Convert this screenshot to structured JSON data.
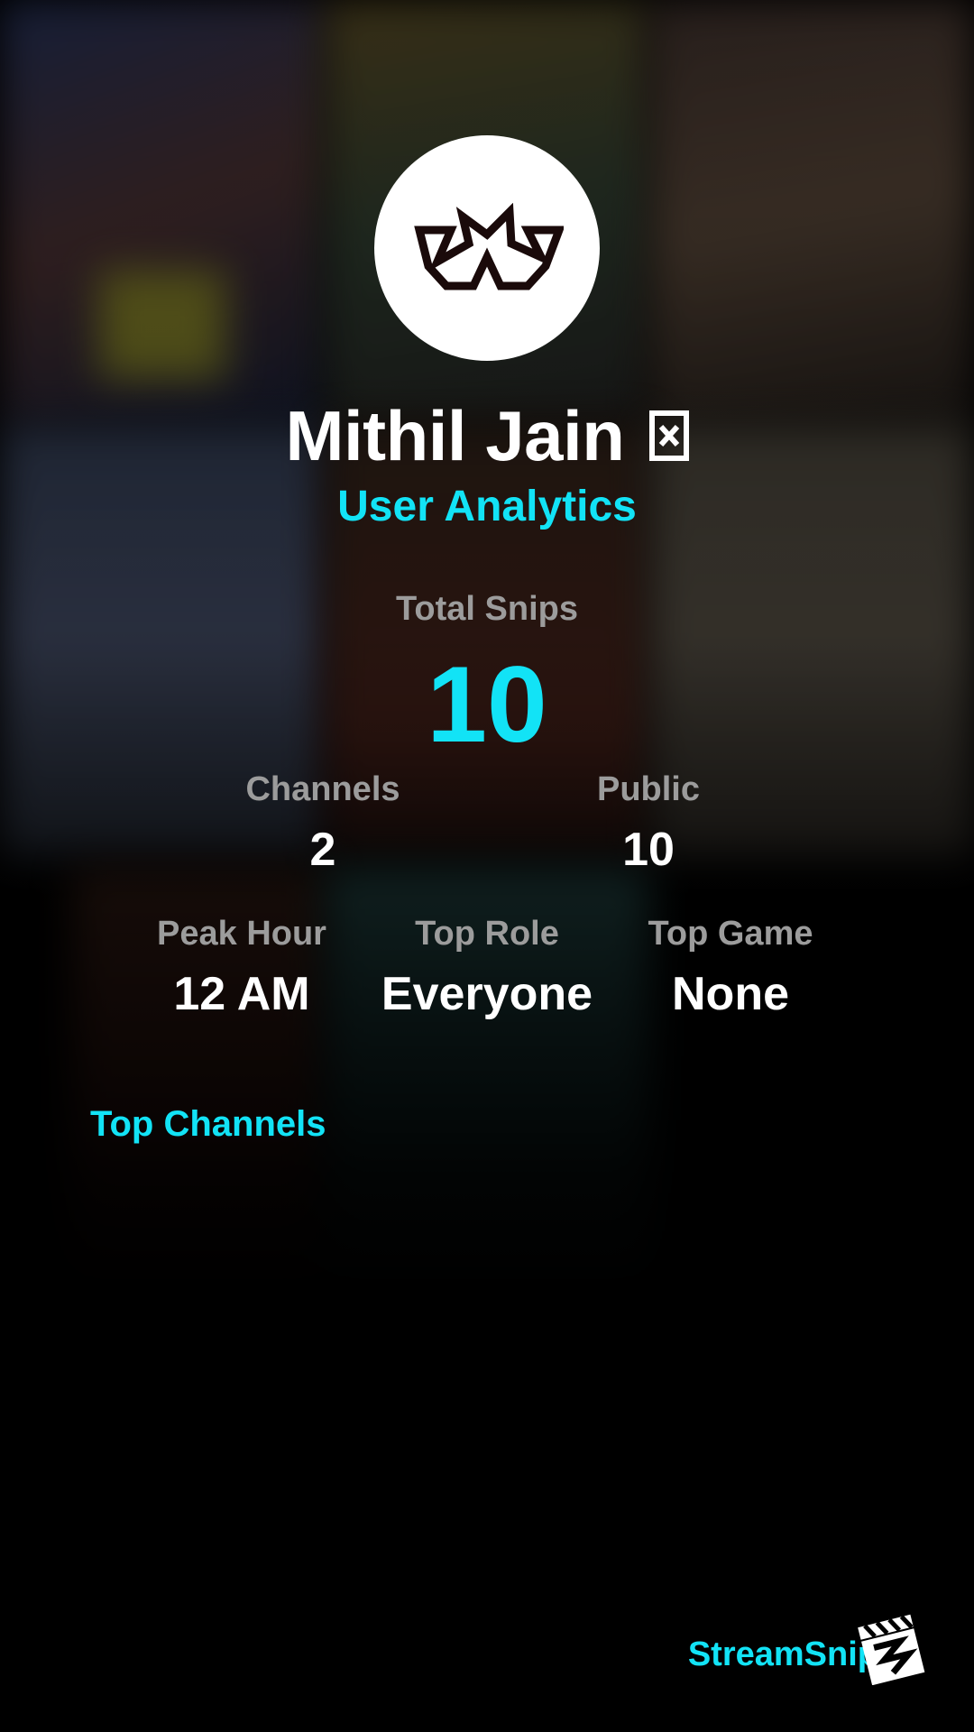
{
  "profile": {
    "username": "Mithil Jain",
    "title_icon": "boxed-x-icon",
    "avatar_icon": "crown-logo-icon",
    "subtitle": "User Analytics"
  },
  "stats": {
    "total_snips_label": "Total Snips",
    "total_snips_value": "10",
    "channels_label": "Channels",
    "channels_value": "2",
    "public_label": "Public",
    "public_value": "10",
    "peak_hour_label": "Peak Hour",
    "peak_hour_value": "12 AM",
    "top_role_label": "Top Role",
    "top_role_value": "Everyone",
    "top_game_label": "Top Game",
    "top_game_value": "None"
  },
  "top_channels": {
    "heading": "Top Channels"
  },
  "brand": {
    "name": "StreamSnip",
    "logo_icon": "clapperboard-logo-icon"
  },
  "colors": {
    "accent": "#12e3f6",
    "label": "#9c9c9c",
    "background": "#000000",
    "text": "#ffffff"
  }
}
